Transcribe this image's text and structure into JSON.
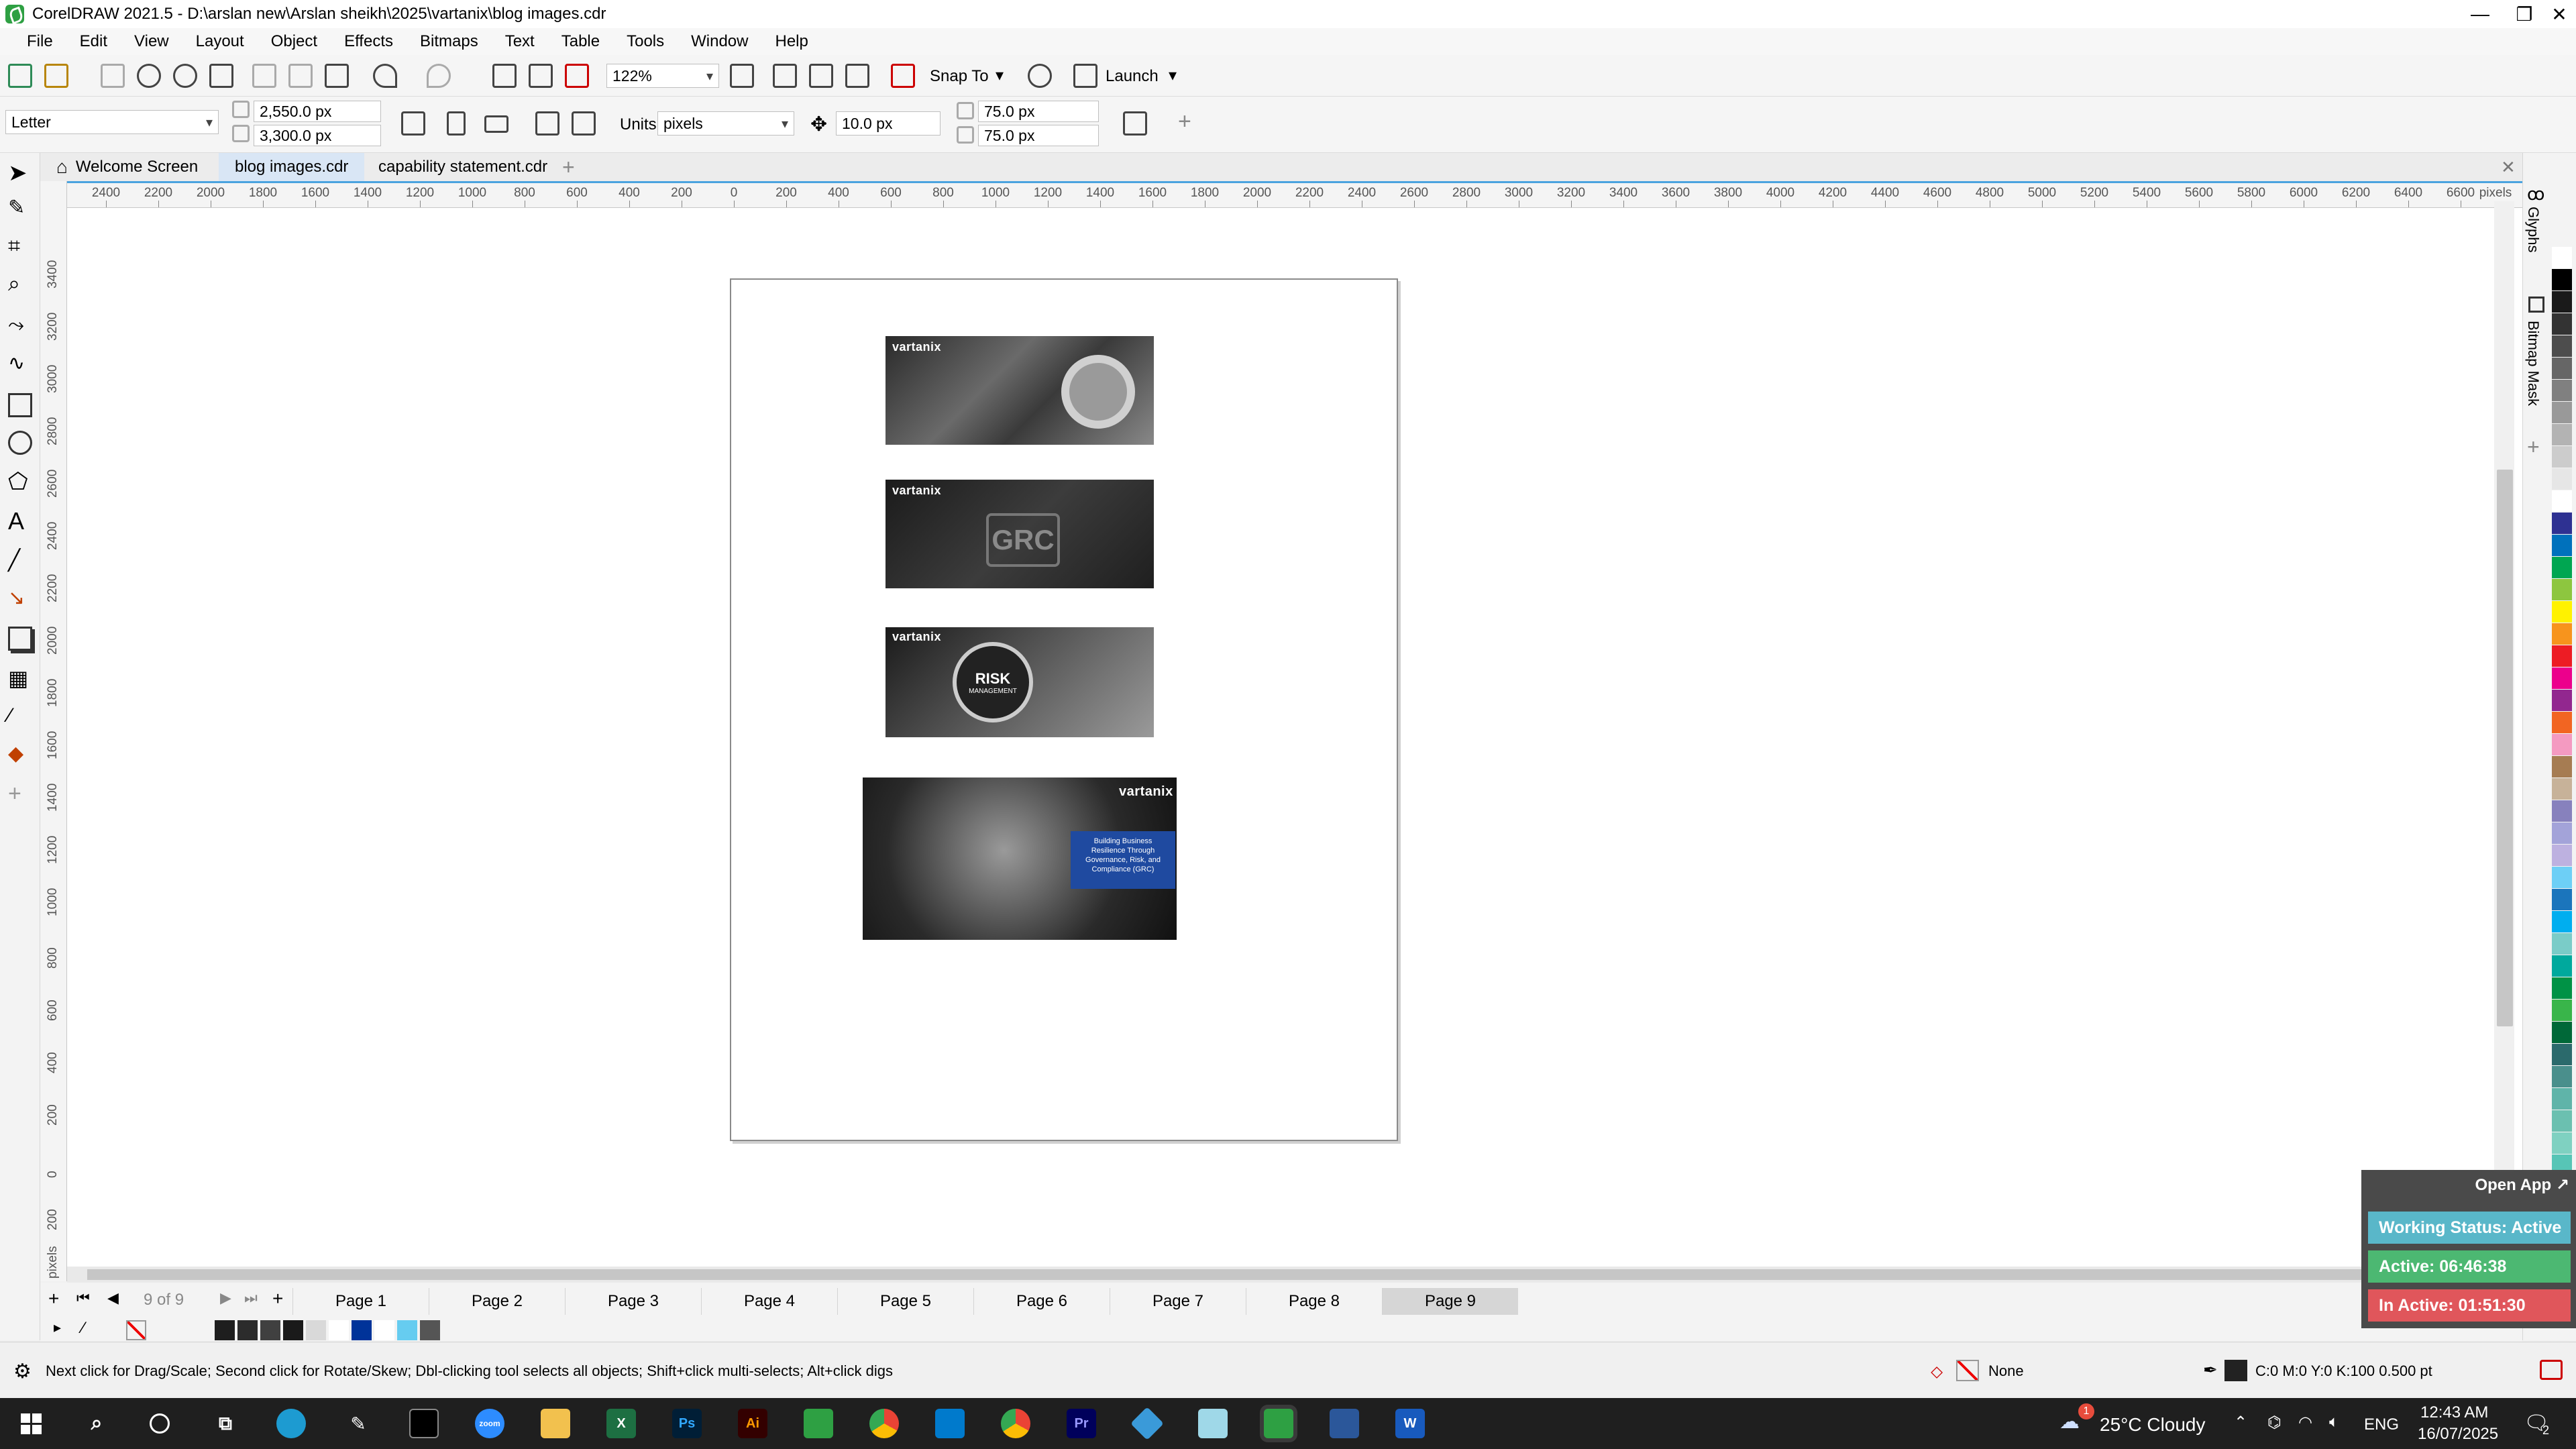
{
  "window": {
    "title": "CorelDRAW 2021.5 - D:\\arslan new\\Arslan sheikh\\2025\\vartanix\\blog images.cdr",
    "minimize": "—",
    "maximize": "❐",
    "close": "✕"
  },
  "menu": [
    "File",
    "Edit",
    "View",
    "Layout",
    "Object",
    "Effects",
    "Bitmaps",
    "Text",
    "Table",
    "Tools",
    "Window",
    "Help"
  ],
  "toolbar": {
    "zoom": "122%",
    "snap_to": "Snap To",
    "launch": "Launch"
  },
  "property_bar": {
    "page_size": "Letter",
    "width": "2,550.0 px",
    "height": "3,300.0 px",
    "units_label": "Units:",
    "units_value": "pixels",
    "nudge": "10.0 px",
    "dup_x": "75.0 px",
    "dup_y": "75.0 px"
  },
  "tabs": [
    {
      "label": "Welcome Screen"
    },
    {
      "label": "blog images.cdr"
    },
    {
      "label": "capability statement.cdr"
    }
  ],
  "ruler": {
    "h_numbers": [
      "2400",
      "2200",
      "2000",
      "1800",
      "1600",
      "1400",
      "1200",
      "1000",
      "800",
      "600",
      "400",
      "200",
      "0",
      "200",
      "400",
      "600",
      "800",
      "1000",
      "1200",
      "1400",
      "1600",
      "1800",
      "2000",
      "2200",
      "2400",
      "2600",
      "2800",
      "3000",
      "3200",
      "3400",
      "3600",
      "3800",
      "4000",
      "4200",
      "4400",
      "4600",
      "4800",
      "5000",
      "5200",
      "5400",
      "5600",
      "5800",
      "6000",
      "6200",
      "6400",
      "6600"
    ],
    "h_unit": "pixels",
    "v_numbers": [
      "3400",
      "3200",
      "3000",
      "2800",
      "2600",
      "2400",
      "2200",
      "2000",
      "1800",
      "1600",
      "1400",
      "1200",
      "1000",
      "800",
      "600",
      "400",
      "200",
      "0",
      "200"
    ],
    "v_unit": "pixels"
  },
  "canvas": {
    "thumb_brand": "vartanix",
    "thumb2_text": "GRC",
    "thumb3_text": "RISK",
    "thumb3_sub": "MANAGEMENT",
    "thumb4_lines": [
      "Building Business",
      "Resilience Through",
      "Governance, Risk, and",
      "Compliance (GRC)"
    ]
  },
  "dockers": {
    "glyphs": "Glyphs",
    "bitmap_mask": "Bitmap Mask"
  },
  "pagebar": {
    "counter": "9 of 9",
    "pages": [
      "Page 1",
      "Page 2",
      "Page 3",
      "Page 4",
      "Page 5",
      "Page 6",
      "Page 7",
      "Page 8",
      "Page 9"
    ],
    "active_page": "Page 9"
  },
  "status": {
    "hint": "Next click for Drag/Scale; Second click for Rotate/Skew; Dbl-clicking tool selects all objects; Shift+click multi-selects; Alt+click digs",
    "fill": "None",
    "outline": "C:0 M:0 Y:0 K:100  0.500 pt"
  },
  "widget": {
    "open_app": "Open App ↗",
    "working_status": "Working Status: Active",
    "active": "Active: 06:46:38",
    "inactive": "In Active: 01:51:30",
    "colors": {
      "working": "#59b7c9",
      "active": "#4cb872",
      "inactive": "#e0565b"
    }
  },
  "taskbar": {
    "weather": "25°C  Cloudy",
    "badge": "1",
    "lang": "ENG",
    "time": "12:43 AM",
    "date": "16/07/2025",
    "notif": "2",
    "apps": [
      "start-icon",
      "search-icon",
      "cortana-icon",
      "taskview-icon",
      "pen-icon",
      "edge-icon",
      "terminal-icon",
      "zoom-icon",
      "explorer-icon",
      "excel-icon",
      "photoshop-icon",
      "illustrator-icon",
      "coreldraw-icon",
      "chrome-icon",
      "vscode-icon",
      "chrome-alt-icon",
      "premiere-icon",
      "app-icon",
      "corel-photo-icon",
      "coreldraw-active-icon",
      "calculator-icon",
      "word-icon"
    ],
    "app_labels": {
      "excel": "X",
      "photoshop": "Ps",
      "illustrator": "Ai",
      "premiere": "Pr",
      "word": "W",
      "zoom": "zoom"
    }
  },
  "palette_colors": [
    "#ffffff",
    "#000000",
    "#1a1a1a",
    "#333333",
    "#4d4d4d",
    "#666666",
    "#808080",
    "#999999",
    "#b3b3b3",
    "#cccccc",
    "#e6e6e6",
    "#ffffff",
    "#2e3192",
    "#0071bc",
    "#00a651",
    "#8dc63f",
    "#fff200",
    "#f7941d",
    "#ed1c24",
    "#ec008c",
    "#92278f",
    "#f26522",
    "#f49ac1",
    "#a67c52",
    "#c7b299",
    "#8781bd",
    "#a3a3d9",
    "#bdb1e0",
    "#6dcff6",
    "#1b75bc",
    "#00aeef",
    "#7accc8",
    "#00a99d",
    "#009245",
    "#39b54a",
    "#006838",
    "#2b6a6c",
    "#4a8f8c",
    "#5fb4a9",
    "#6bc0b0",
    "#7fd1c1",
    "#57c5b6"
  ],
  "doc_palette": [
    "#1e1e1e",
    "#2c2c2c",
    "#404040",
    "#1a1a1a",
    "#d9d9d9",
    "#ffffff",
    "#003399",
    "#ffffff",
    "#66ccf0",
    "#555555"
  ]
}
